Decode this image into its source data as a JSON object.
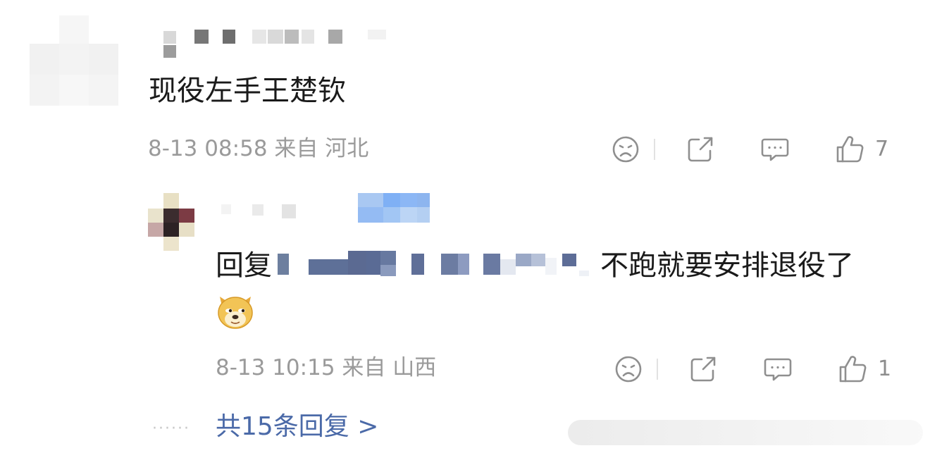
{
  "main_comment": {
    "body": "现役左手王楚钦",
    "meta": "8-13 08:58 来自 河北",
    "likes": "7"
  },
  "reply": {
    "prefix": "回复",
    "body": "不跑就要安排退役了",
    "meta": "8-13 10:15 来自 山西",
    "likes": "1",
    "emoji": "doge-emoji"
  },
  "footer": {
    "more_replies": "共15条回复 >",
    "dots": "······"
  },
  "icons": {
    "dislike": "sad-face-icon",
    "share": "share-icon",
    "comment": "comment-icon",
    "like": "thumbs-up-icon"
  },
  "colors": {
    "text": "#1a1a1a",
    "meta": "#9a9a9a",
    "link": "#4b6aa8",
    "icon": "#8f8f8f"
  }
}
